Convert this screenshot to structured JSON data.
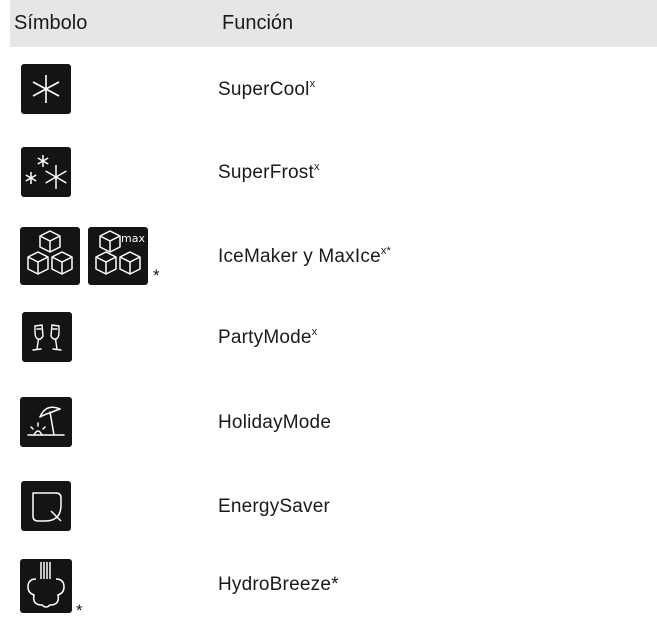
{
  "header": {
    "symbol_label": "Símbolo",
    "function_label": "Función"
  },
  "rows": [
    {
      "icon": "supercool-snowflake-icon",
      "name": "SuperCool",
      "sup": "x",
      "note": ""
    },
    {
      "icon": "superfrost-snowflakes-icon",
      "name": "SuperFrost",
      "sup": "x",
      "note": ""
    },
    {
      "icon": "icemaker-cubes-icon",
      "icon2": "maxice-cubes-icon",
      "icon2_label": "max",
      "icon_note": "*",
      "name": "IceMaker y MaxIce",
      "sup": "x*",
      "note": ""
    },
    {
      "icon": "partymode-glasses-icon",
      "name": "PartyMode",
      "sup": "x",
      "note": ""
    },
    {
      "icon": "holidaymode-umbrella-icon",
      "name": "HolidayMode",
      "sup": "",
      "note": ""
    },
    {
      "icon": "energysaver-leaf-icon",
      "name": "EnergySaver",
      "sup": "",
      "note": ""
    },
    {
      "icon": "hydrobreeze-icon",
      "icon_note": "*",
      "name": "HydroBreeze*",
      "sup": "",
      "note": ""
    }
  ],
  "colors": {
    "header_bg": "#e6e6e6",
    "icon_bg": "#141414",
    "icon_stroke": "#ffffff"
  }
}
